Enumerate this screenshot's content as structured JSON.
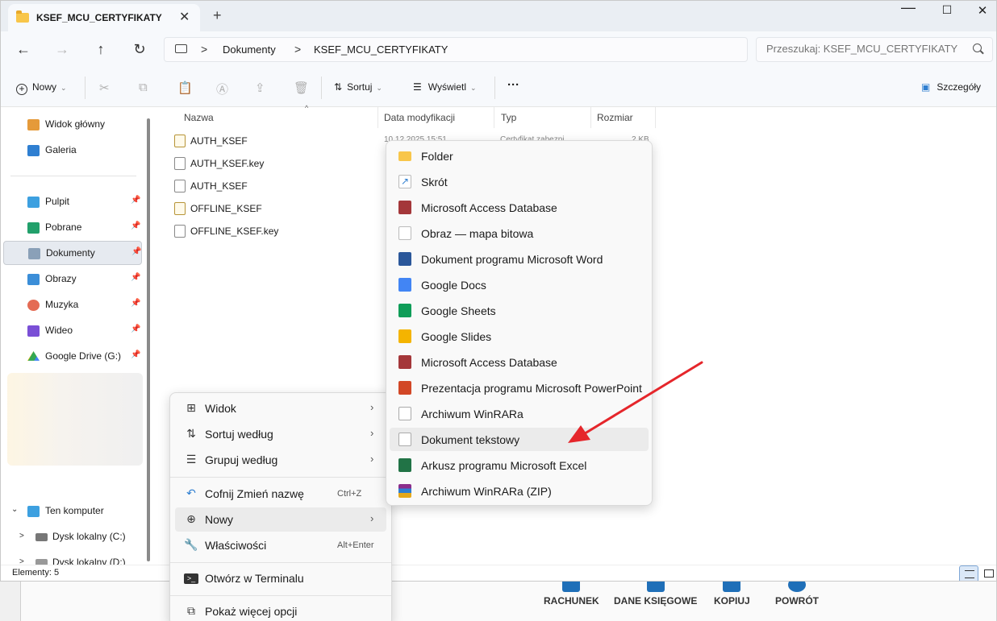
{
  "window": {
    "tab_title": "KSEF_MCU_CERTYFIKATY",
    "tab_close": "✕",
    "new_tab": "+",
    "minimize": "—",
    "maximize": "☐",
    "close": "✕"
  },
  "address": {
    "crumbs": [
      "Dokumenty",
      "KSEF_MCU_CERTYFIKATY"
    ],
    "separator": ">",
    "search_placeholder": "Przeszukaj: KSEF_MCU_CERTYFIKATY"
  },
  "nav": {
    "back": "←",
    "forward": "→",
    "up": "↑",
    "refresh": "↻"
  },
  "toolbar": {
    "new_label": "Nowy",
    "sort_label": "Sortuj",
    "view_label": "Wyświetl",
    "more_label": "···",
    "details_label": "Szczegóły",
    "icons": [
      "cut-icon",
      "copy-icon",
      "paste-icon",
      "rename-icon",
      "share-icon",
      "delete-icon"
    ]
  },
  "sidebar": {
    "top_items": [
      {
        "label": "Widok główny",
        "icon": "home-icon",
        "color": "#e59a3a"
      },
      {
        "label": "Galeria",
        "icon": "gallery-icon",
        "color": "#2f7fd1"
      }
    ],
    "pinned_items": [
      {
        "label": "Pulpit",
        "icon": "desktop-icon",
        "color": "#3da0e0"
      },
      {
        "label": "Pobrane",
        "icon": "download-icon",
        "color": "#22a06b"
      },
      {
        "label": "Dokumenty",
        "icon": "documents-icon",
        "color": "#8aa0b8"
      },
      {
        "label": "Obrazy",
        "icon": "pictures-icon",
        "color": "#3b8ed8"
      },
      {
        "label": "Muzyka",
        "icon": "music-icon",
        "color": "#e46b54"
      },
      {
        "label": "Wideo",
        "icon": "video-icon",
        "color": "#7a4fd6"
      },
      {
        "label": "Google Drive (G:)",
        "icon": "google-drive-icon",
        "color": "#34a853"
      }
    ],
    "pin_glyph": "📌",
    "tree": [
      {
        "label": "Ten komputer",
        "icon": "computer-icon",
        "arrow": "⌄"
      },
      {
        "label": "Dysk lokalny (C:)",
        "icon": "drive-icon",
        "arrow": ">"
      },
      {
        "label": "Dysk lokalny (D:)",
        "icon": "drive-icon",
        "arrow": ">"
      }
    ]
  },
  "columns": [
    "Nazwa",
    "Data modyfikacji",
    "Typ",
    "Rozmiar"
  ],
  "files": [
    {
      "name": "AUTH_KSEF",
      "date": "10.12.2025 15:51",
      "type": "Certyfikat zabezpi...",
      "size": "2 KB",
      "kind": "cert"
    },
    {
      "name": "AUTH_KSEF.key",
      "date": "",
      "type": "",
      "size": "",
      "kind": "file"
    },
    {
      "name": "AUTH_KSEF",
      "date": "",
      "type": "",
      "size": "",
      "kind": "file"
    },
    {
      "name": "OFFLINE_KSEF",
      "date": "",
      "type": "",
      "size": "",
      "kind": "cert"
    },
    {
      "name": "OFFLINE_KSEF.key",
      "date": "",
      "type": "",
      "size": "",
      "kind": "file"
    }
  ],
  "status": {
    "count": "Elementy: 5"
  },
  "context_menu": {
    "items": [
      {
        "label": "Widok",
        "icon": "view-icon",
        "glyph": "⊞",
        "arrow": "›"
      },
      {
        "label": "Sortuj według",
        "icon": "sort-icon",
        "glyph": "⇅",
        "arrow": "›"
      },
      {
        "label": "Grupuj według",
        "icon": "group-icon",
        "glyph": "☰",
        "arrow": "›"
      },
      {
        "label": "Cofnij Zmień nazwę",
        "icon": "undo-icon",
        "glyph": "↶",
        "shortcut": "Ctrl+Z"
      },
      {
        "label": "Nowy",
        "icon": "new-icon",
        "glyph": "⊕",
        "arrow": "›"
      },
      {
        "label": "Właściwości",
        "icon": "properties-icon",
        "glyph": "🔧",
        "shortcut": "Alt+Enter"
      },
      {
        "label": "Otwórz w Terminalu",
        "icon": "terminal-icon",
        "glyph": "▭"
      },
      {
        "label": "Pokaż więcej opcji",
        "icon": "more-options-icon",
        "glyph": "⧉"
      }
    ]
  },
  "submenu": {
    "items": [
      {
        "label": "Folder",
        "icon": "folder-icon",
        "color": "#f8c64a"
      },
      {
        "label": "Skrót",
        "icon": "shortcut-icon",
        "color": "#2f7fd1"
      },
      {
        "label": "Microsoft Access Database",
        "icon": "access-icon",
        "color": "#a4373a"
      },
      {
        "label": "Obraz — mapa bitowa",
        "icon": "bitmap-icon",
        "color": "#3b8ed8"
      },
      {
        "label": "Dokument programu Microsoft Word",
        "icon": "word-icon",
        "color": "#2b579a"
      },
      {
        "label": "Google Docs",
        "icon": "google-docs-icon",
        "color": "#4285f4"
      },
      {
        "label": "Google Sheets",
        "icon": "google-sheets-icon",
        "color": "#0f9d58"
      },
      {
        "label": "Google Slides",
        "icon": "google-slides-icon",
        "color": "#f4b400"
      },
      {
        "label": "Microsoft Access Database",
        "icon": "access-icon",
        "color": "#a4373a"
      },
      {
        "label": "Prezentacja programu Microsoft PowerPoint",
        "icon": "powerpoint-icon",
        "color": "#d24726"
      },
      {
        "label": "Archiwum WinRARa",
        "icon": "winrar-icon",
        "color": "#9a9a9a"
      },
      {
        "label": "Dokument tekstowy",
        "icon": "text-document-icon",
        "color": "#9a9a9a"
      },
      {
        "label": "Arkusz programu Microsoft Excel",
        "icon": "excel-icon",
        "color": "#217346"
      },
      {
        "label": "Archiwum WinRARa (ZIP)",
        "icon": "winrar-zip-icon",
        "color": "#8b2d8b"
      }
    ]
  },
  "background_app": {
    "buttons": [
      "RACHUNEK",
      "DANE KSIĘGOWE",
      "KOPIUJ",
      "POWRÓT"
    ]
  },
  "colors": {
    "accent": "#1f6fb8",
    "annotation_arrow": "#e5262b"
  }
}
